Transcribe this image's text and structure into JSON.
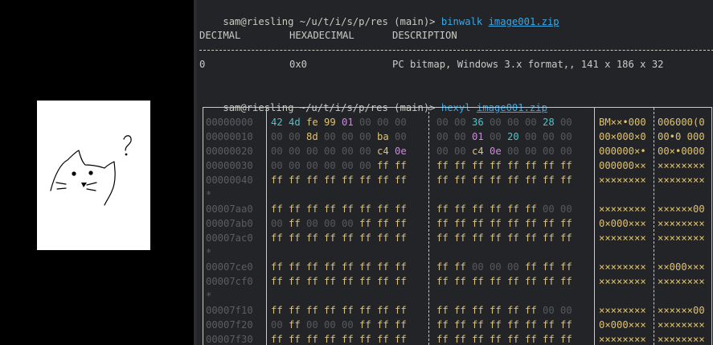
{
  "colors": {
    "terminal_bg": "#232427",
    "prompt_fg": "#c9cbc3",
    "command": "#3aa8e5",
    "offset": "#5a5d62",
    "null_byte": "#55585d",
    "ascii_byte": "#4ec3c7",
    "other_byte": "#e0c26a",
    "control_byte": "#c98bd6"
  },
  "viewer": {
    "image_icon": "cat-doodle-icon"
  },
  "prompt1": {
    "host": "sam@riesling ~/u/t/i/s/p/res (main)> ",
    "command": "binwalk",
    "arg": "image001.zip"
  },
  "binwalk": {
    "headers": [
      "DECIMAL",
      "HEXADECIMAL",
      "DESCRIPTION"
    ],
    "rule": "--------------------------------------------------------------------------------",
    "row": [
      "0",
      "0x0",
      "PC bitmap, Windows 3.x format,, 141 x 186 x 32"
    ]
  },
  "prompt2": {
    "host": "sam@riesling ~/u/t/i/s/p/res (main)> ",
    "command": "hexyl",
    "arg": "image001.zip"
  },
  "hexyl": {
    "rows": [
      {
        "offset": "00000000",
        "g1": [
          [
            "42",
            "a"
          ],
          [
            "4d",
            "a"
          ],
          [
            "fe",
            "o"
          ],
          [
            "99",
            "o"
          ],
          [
            "01",
            "p"
          ],
          [
            "00",
            "n"
          ],
          [
            "00",
            "n"
          ],
          [
            "00",
            "n"
          ]
        ],
        "g2": [
          [
            "00",
            "n"
          ],
          [
            "00",
            "n"
          ],
          [
            "36",
            "a"
          ],
          [
            "00",
            "n"
          ],
          [
            "00",
            "n"
          ],
          [
            "00",
            "n"
          ],
          [
            "28",
            "a"
          ],
          [
            "00",
            "n"
          ]
        ],
        "c1": "BM××•000",
        "c2": "006000(0"
      },
      {
        "offset": "00000010",
        "g1": [
          [
            "00",
            "n"
          ],
          [
            "00",
            "n"
          ],
          [
            "8d",
            "o"
          ],
          [
            "00",
            "n"
          ],
          [
            "00",
            "n"
          ],
          [
            "00",
            "n"
          ],
          [
            "ba",
            "o"
          ],
          [
            "00",
            "n"
          ]
        ],
        "g2": [
          [
            "00",
            "n"
          ],
          [
            "00",
            "n"
          ],
          [
            "01",
            "p"
          ],
          [
            "00",
            "n"
          ],
          [
            "20",
            "a"
          ],
          [
            "00",
            "n"
          ],
          [
            "00",
            "n"
          ],
          [
            "00",
            "n"
          ]
        ],
        "c1": "00×000×0",
        "c2": "00•0 000"
      },
      {
        "offset": "00000020",
        "g1": [
          [
            "00",
            "n"
          ],
          [
            "00",
            "n"
          ],
          [
            "00",
            "n"
          ],
          [
            "00",
            "n"
          ],
          [
            "00",
            "n"
          ],
          [
            "00",
            "n"
          ],
          [
            "c4",
            "o"
          ],
          [
            "0e",
            "p"
          ]
        ],
        "g2": [
          [
            "00",
            "n"
          ],
          [
            "00",
            "n"
          ],
          [
            "c4",
            "o"
          ],
          [
            "0e",
            "p"
          ],
          [
            "00",
            "n"
          ],
          [
            "00",
            "n"
          ],
          [
            "00",
            "n"
          ],
          [
            "00",
            "n"
          ]
        ],
        "c1": "000000×•",
        "c2": "00×•0000"
      },
      {
        "offset": "00000030",
        "g1": [
          [
            "00",
            "n"
          ],
          [
            "00",
            "n"
          ],
          [
            "00",
            "n"
          ],
          [
            "00",
            "n"
          ],
          [
            "00",
            "n"
          ],
          [
            "00",
            "n"
          ],
          [
            "ff",
            "o"
          ],
          [
            "ff",
            "o"
          ]
        ],
        "g2": [
          [
            "ff",
            "o"
          ],
          [
            "ff",
            "o"
          ],
          [
            "ff",
            "o"
          ],
          [
            "ff",
            "o"
          ],
          [
            "ff",
            "o"
          ],
          [
            "ff",
            "o"
          ],
          [
            "ff",
            "o"
          ],
          [
            "ff",
            "o"
          ]
        ],
        "c1": "000000××",
        "c2": "××××××××"
      },
      {
        "offset": "00000040",
        "g1": [
          [
            "ff",
            "o"
          ],
          [
            "ff",
            "o"
          ],
          [
            "ff",
            "o"
          ],
          [
            "ff",
            "o"
          ],
          [
            "ff",
            "o"
          ],
          [
            "ff",
            "o"
          ],
          [
            "ff",
            "o"
          ],
          [
            "ff",
            "o"
          ]
        ],
        "g2": [
          [
            "ff",
            "o"
          ],
          [
            "ff",
            "o"
          ],
          [
            "ff",
            "o"
          ],
          [
            "ff",
            "o"
          ],
          [
            "ff",
            "o"
          ],
          [
            "ff",
            "o"
          ],
          [
            "ff",
            "o"
          ],
          [
            "ff",
            "o"
          ]
        ],
        "c1": "××××××××",
        "c2": "××××××××"
      },
      {
        "star": "*"
      },
      {
        "offset": "00007aa0",
        "g1": [
          [
            "ff",
            "o"
          ],
          [
            "ff",
            "o"
          ],
          [
            "ff",
            "o"
          ],
          [
            "ff",
            "o"
          ],
          [
            "ff",
            "o"
          ],
          [
            "ff",
            "o"
          ],
          [
            "ff",
            "o"
          ],
          [
            "ff",
            "o"
          ]
        ],
        "g2": [
          [
            "ff",
            "o"
          ],
          [
            "ff",
            "o"
          ],
          [
            "ff",
            "o"
          ],
          [
            "ff",
            "o"
          ],
          [
            "ff",
            "o"
          ],
          [
            "ff",
            "o"
          ],
          [
            "00",
            "n"
          ],
          [
            "00",
            "n"
          ]
        ],
        "c1": "××××××××",
        "c2": "××××××00"
      },
      {
        "offset": "00007ab0",
        "g1": [
          [
            "00",
            "n"
          ],
          [
            "ff",
            "o"
          ],
          [
            "00",
            "n"
          ],
          [
            "00",
            "n"
          ],
          [
            "00",
            "n"
          ],
          [
            "ff",
            "o"
          ],
          [
            "ff",
            "o"
          ],
          [
            "ff",
            "o"
          ]
        ],
        "g2": [
          [
            "ff",
            "o"
          ],
          [
            "ff",
            "o"
          ],
          [
            "ff",
            "o"
          ],
          [
            "ff",
            "o"
          ],
          [
            "ff",
            "o"
          ],
          [
            "ff",
            "o"
          ],
          [
            "ff",
            "o"
          ],
          [
            "ff",
            "o"
          ]
        ],
        "c1": "0×000×××",
        "c2": "××××××××"
      },
      {
        "offset": "00007ac0",
        "g1": [
          [
            "ff",
            "o"
          ],
          [
            "ff",
            "o"
          ],
          [
            "ff",
            "o"
          ],
          [
            "ff",
            "o"
          ],
          [
            "ff",
            "o"
          ],
          [
            "ff",
            "o"
          ],
          [
            "ff",
            "o"
          ],
          [
            "ff",
            "o"
          ]
        ],
        "g2": [
          [
            "ff",
            "o"
          ],
          [
            "ff",
            "o"
          ],
          [
            "ff",
            "o"
          ],
          [
            "ff",
            "o"
          ],
          [
            "ff",
            "o"
          ],
          [
            "ff",
            "o"
          ],
          [
            "ff",
            "o"
          ],
          [
            "ff",
            "o"
          ]
        ],
        "c1": "××××××××",
        "c2": "××××××××"
      },
      {
        "star": "*"
      },
      {
        "offset": "00007ce0",
        "g1": [
          [
            "ff",
            "o"
          ],
          [
            "ff",
            "o"
          ],
          [
            "ff",
            "o"
          ],
          [
            "ff",
            "o"
          ],
          [
            "ff",
            "o"
          ],
          [
            "ff",
            "o"
          ],
          [
            "ff",
            "o"
          ],
          [
            "ff",
            "o"
          ]
        ],
        "g2": [
          [
            "ff",
            "o"
          ],
          [
            "ff",
            "o"
          ],
          [
            "00",
            "n"
          ],
          [
            "00",
            "n"
          ],
          [
            "00",
            "n"
          ],
          [
            "ff",
            "o"
          ],
          [
            "ff",
            "o"
          ],
          [
            "ff",
            "o"
          ]
        ],
        "c1": "××××××××",
        "c2": "××000×××"
      },
      {
        "offset": "00007cf0",
        "g1": [
          [
            "ff",
            "o"
          ],
          [
            "ff",
            "o"
          ],
          [
            "ff",
            "o"
          ],
          [
            "ff",
            "o"
          ],
          [
            "ff",
            "o"
          ],
          [
            "ff",
            "o"
          ],
          [
            "ff",
            "o"
          ],
          [
            "ff",
            "o"
          ]
        ],
        "g2": [
          [
            "ff",
            "o"
          ],
          [
            "ff",
            "o"
          ],
          [
            "ff",
            "o"
          ],
          [
            "ff",
            "o"
          ],
          [
            "ff",
            "o"
          ],
          [
            "ff",
            "o"
          ],
          [
            "ff",
            "o"
          ],
          [
            "ff",
            "o"
          ]
        ],
        "c1": "××××××××",
        "c2": "××××××××"
      },
      {
        "star": "*"
      },
      {
        "offset": "00007f10",
        "g1": [
          [
            "ff",
            "o"
          ],
          [
            "ff",
            "o"
          ],
          [
            "ff",
            "o"
          ],
          [
            "ff",
            "o"
          ],
          [
            "ff",
            "o"
          ],
          [
            "ff",
            "o"
          ],
          [
            "ff",
            "o"
          ],
          [
            "ff",
            "o"
          ]
        ],
        "g2": [
          [
            "ff",
            "o"
          ],
          [
            "ff",
            "o"
          ],
          [
            "ff",
            "o"
          ],
          [
            "ff",
            "o"
          ],
          [
            "ff",
            "o"
          ],
          [
            "ff",
            "o"
          ],
          [
            "00",
            "n"
          ],
          [
            "00",
            "n"
          ]
        ],
        "c1": "××××××××",
        "c2": "××××××00"
      },
      {
        "offset": "00007f20",
        "g1": [
          [
            "00",
            "n"
          ],
          [
            "ff",
            "o"
          ],
          [
            "00",
            "n"
          ],
          [
            "00",
            "n"
          ],
          [
            "00",
            "n"
          ],
          [
            "ff",
            "o"
          ],
          [
            "ff",
            "o"
          ],
          [
            "ff",
            "o"
          ]
        ],
        "g2": [
          [
            "ff",
            "o"
          ],
          [
            "ff",
            "o"
          ],
          [
            "ff",
            "o"
          ],
          [
            "ff",
            "o"
          ],
          [
            "ff",
            "o"
          ],
          [
            "ff",
            "o"
          ],
          [
            "ff",
            "o"
          ],
          [
            "ff",
            "o"
          ]
        ],
        "c1": "0×000×××",
        "c2": "××××××××"
      },
      {
        "offset": "00007f30",
        "g1": [
          [
            "ff",
            "o"
          ],
          [
            "ff",
            "o"
          ],
          [
            "ff",
            "o"
          ],
          [
            "ff",
            "o"
          ],
          [
            "ff",
            "o"
          ],
          [
            "ff",
            "o"
          ],
          [
            "ff",
            "o"
          ],
          [
            "ff",
            "o"
          ]
        ],
        "g2": [
          [
            "ff",
            "o"
          ],
          [
            "ff",
            "o"
          ],
          [
            "ff",
            "o"
          ],
          [
            "ff",
            "o"
          ],
          [
            "ff",
            "o"
          ],
          [
            "ff",
            "o"
          ],
          [
            "ff",
            "o"
          ],
          [
            "ff",
            "o"
          ]
        ],
        "c1": "××××××××",
        "c2": "××××××××"
      }
    ]
  }
}
